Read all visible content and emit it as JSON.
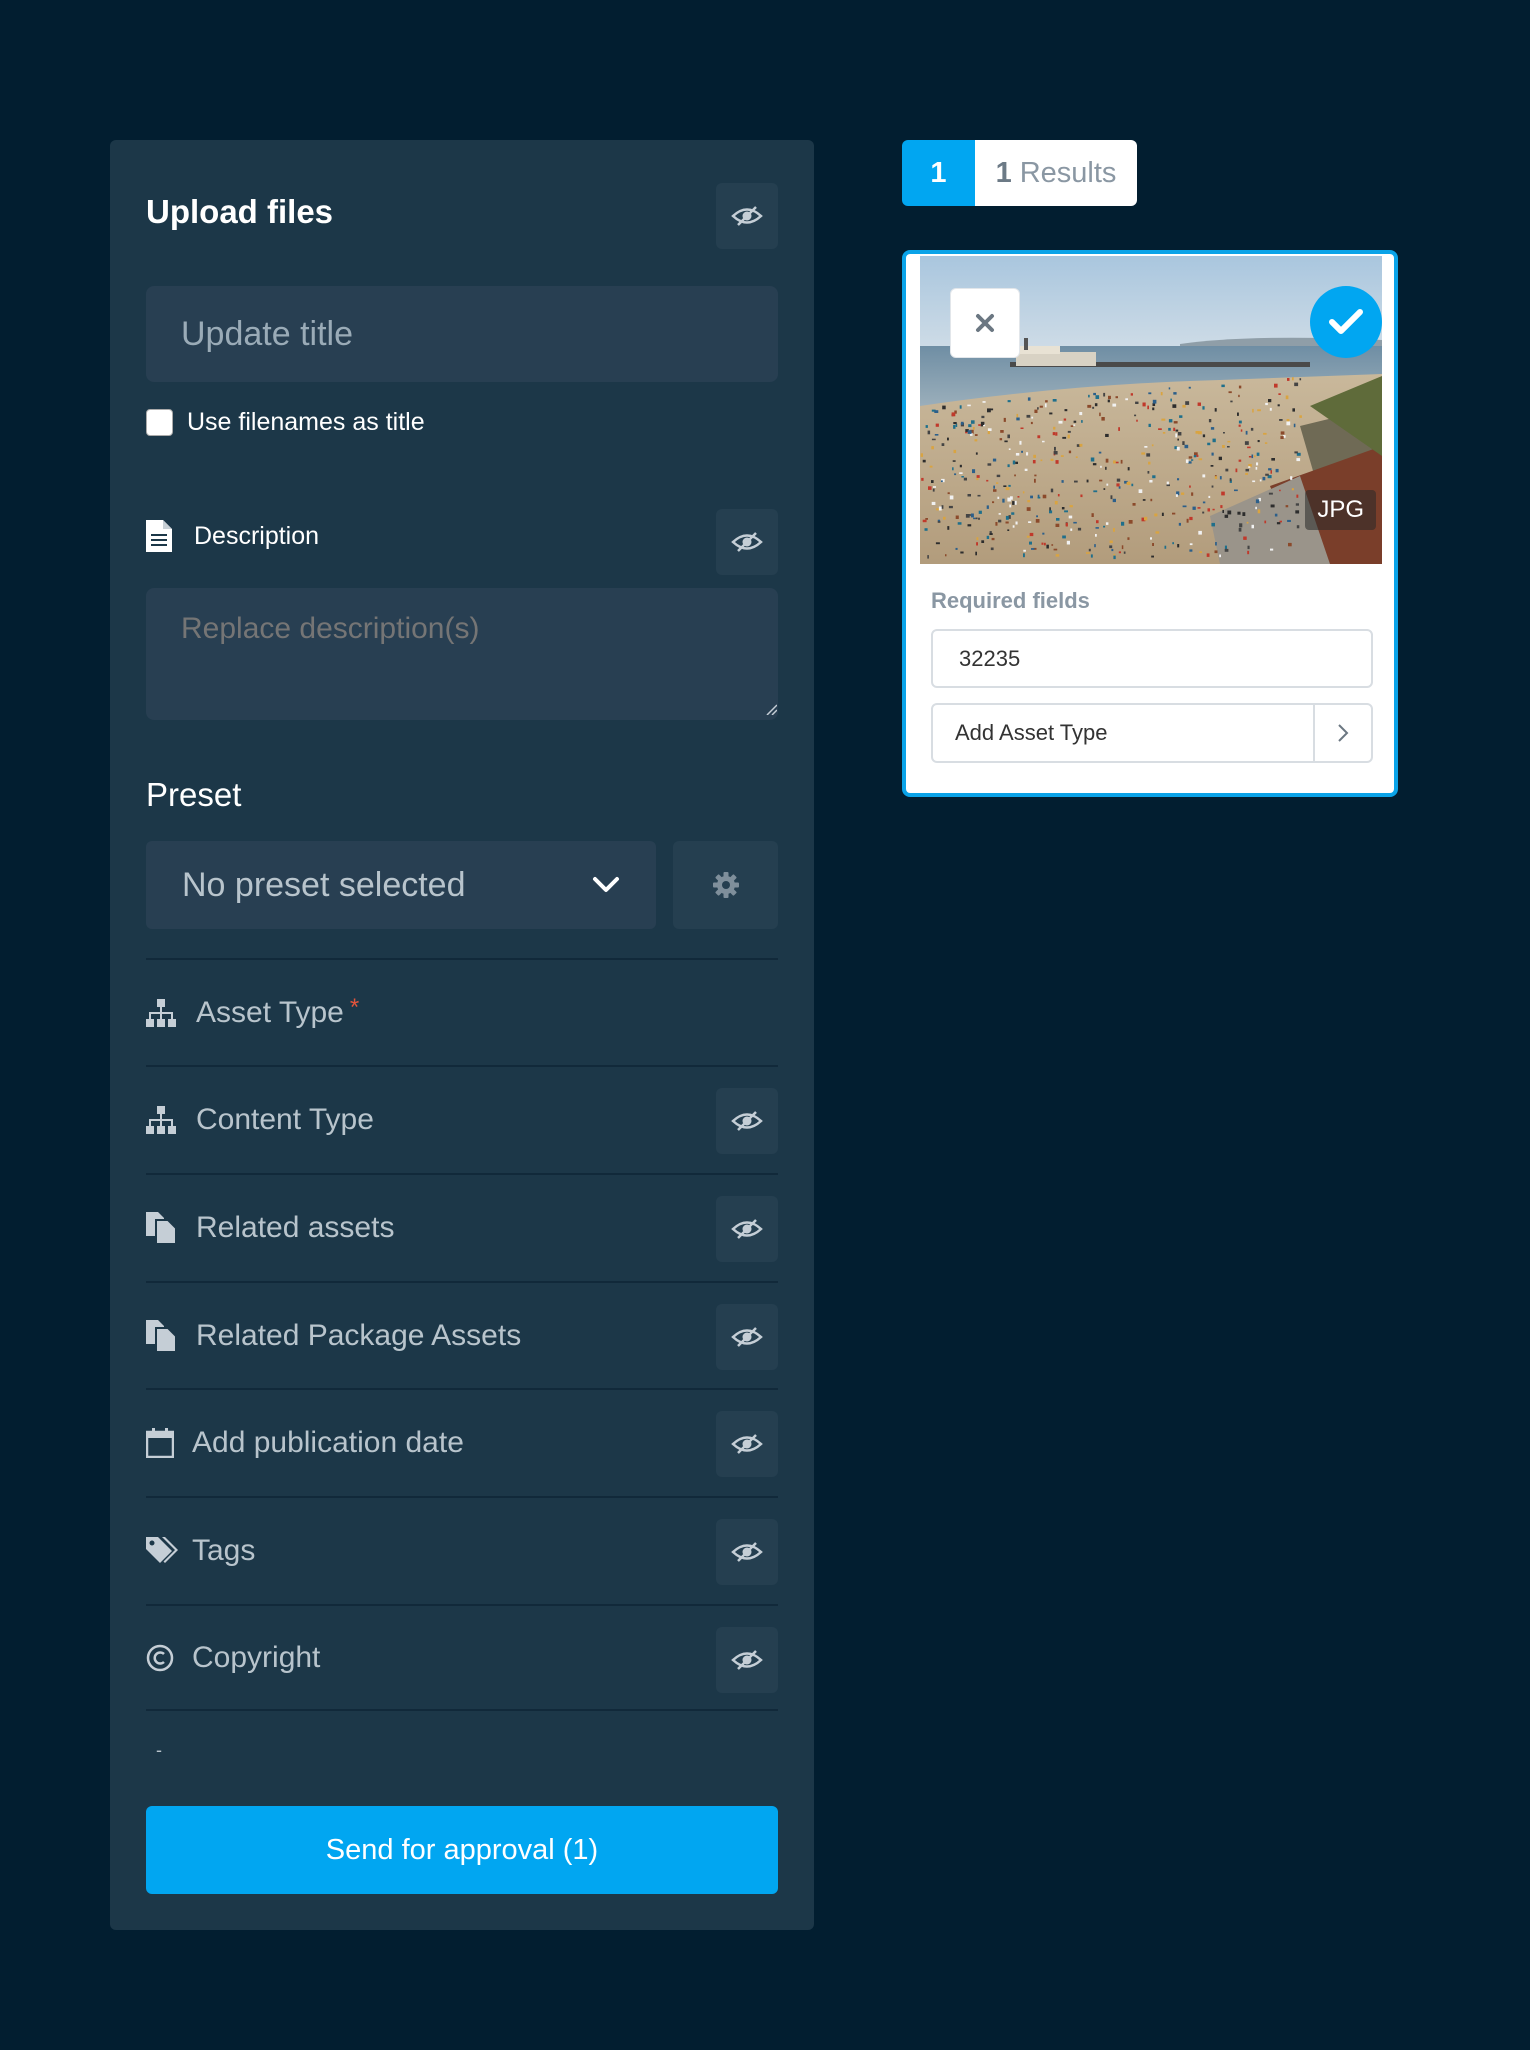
{
  "upload_panel": {
    "title": "Upload files",
    "title_placeholder": "Update title",
    "use_filenames_label": "Use filenames as title",
    "description_label": "Description",
    "description_placeholder": "Replace description(s)",
    "preset_label": "Preset",
    "preset_selected": "No preset selected",
    "fields": {
      "asset_type": "Asset Type",
      "asset_type_required": "*",
      "content_type": "Content Type",
      "related_assets": "Related assets",
      "related_package_assets": "Related Package Assets",
      "publication_date": "Add publication date",
      "tags": "Tags",
      "copyright": "Copyright"
    },
    "dash": "-",
    "send_button": "Send for approval (1)"
  },
  "results": {
    "page_number": "1",
    "count": "1",
    "label": "Results"
  },
  "asset_card": {
    "format_badge": "JPG",
    "required_fields_label": "Required fields",
    "id_value": "32235",
    "asset_type_placeholder": "Add Asset Type"
  },
  "colors": {
    "background": "#021e30",
    "panel": "#1c3748",
    "input": "#283f52",
    "accent": "#01a6f1",
    "required": "#e2543c"
  },
  "icons": [
    "eye-slash-icon",
    "file-text-icon",
    "chevron-down-icon",
    "gear-icon",
    "sitemap-icon",
    "copy-icon",
    "calendar-icon",
    "tags-icon",
    "copyright-icon",
    "close-icon",
    "check-icon",
    "chevron-right-icon"
  ]
}
